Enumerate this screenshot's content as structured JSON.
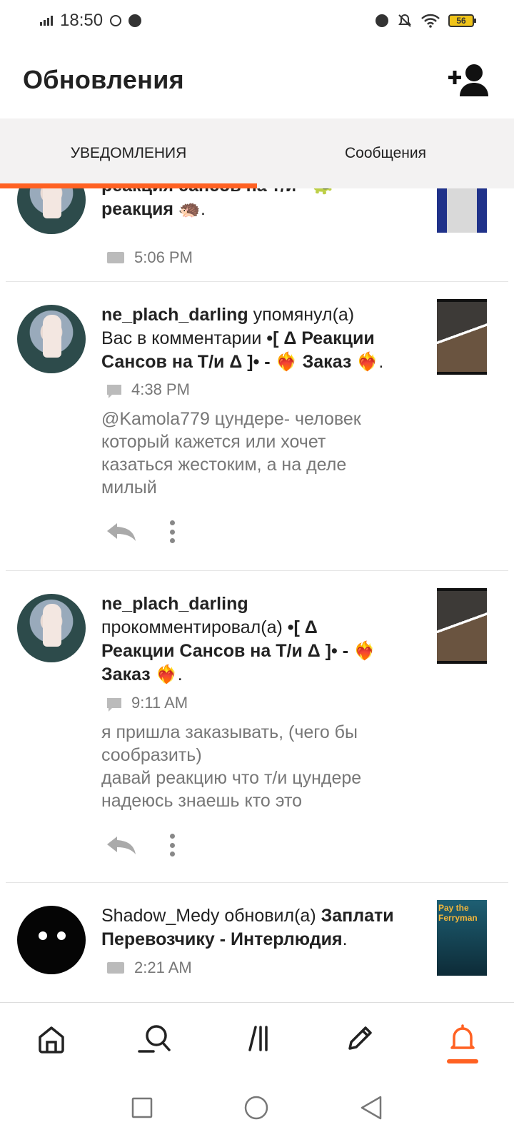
{
  "status_bar": {
    "time": "18:50",
    "battery": "56"
  },
  "header": {
    "title": "Обновления"
  },
  "tabs": [
    {
      "label": "УВЕДОМЛЕНИЯ",
      "active": true
    },
    {
      "label": "Сообщения",
      "active": false
    }
  ],
  "notifications": [
    {
      "line1_title": "реакция сансов на т/и - 🐢",
      "line2_title": "реакция 🦔",
      "line2_end": ".",
      "time": "5:06 PM",
      "icon": "book-icon"
    },
    {
      "user": "ne_plach_darling",
      "action1": " упомянул(а)",
      "action2": "Вас в комментарии ",
      "story_line1": "•[ Δ Реакции",
      "story_line2": "Сансов на Т/и Δ ]• - ❤️‍🔥 Заказ ❤️‍🔥",
      "end": ".",
      "time": "4:38 PM",
      "icon": "comment-icon",
      "comment": "@Kamola779 цундере- человек\nкоторый кажется или хочет\nказаться жестоким, а на деле\nмилый"
    },
    {
      "user": "ne_plach_darling",
      "action": "прокомментировал(а) ",
      "story_line1a": "•[ Δ",
      "story_line2": "Реакции Сансов на Т/и Δ ]• - ❤️‍🔥",
      "story_line3": "Заказ ❤️‍🔥",
      "end": ".",
      "time": "9:11 AM",
      "icon": "comment-icon",
      "comment": "я пришла заказывать, (чего бы\nсообразить)\nдавай реакцию что т/и цундере\nнадеюсь знаешь кто это"
    },
    {
      "user": "Shadow_Medy",
      "action": " обновил(а) ",
      "story_line1": "Заплати",
      "story_line2": "Перевозчику - Интерлюдия",
      "end": ".",
      "time": "2:21 AM",
      "icon": "book-icon",
      "thumb_text": "Pay the Ferryman"
    }
  ],
  "bottom_nav": [
    "home-icon",
    "search-icon",
    "library-icon",
    "write-icon",
    "bell-icon"
  ],
  "accent_color": "#ff6122"
}
